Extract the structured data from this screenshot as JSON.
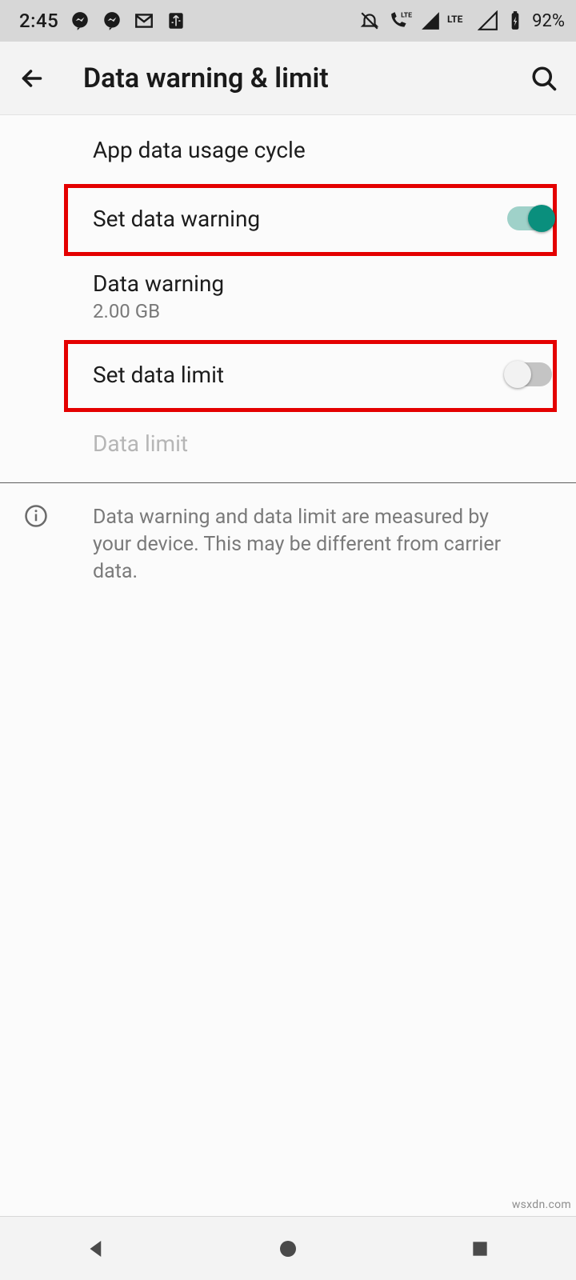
{
  "status": {
    "time": "2:45",
    "battery_percent": "92%"
  },
  "header": {
    "title": "Data warning & limit"
  },
  "rows": {
    "usage_cycle": {
      "label": "App data usage cycle"
    },
    "set_warning": {
      "label": "Set data warning",
      "enabled": true
    },
    "data_warning": {
      "label": "Data warning",
      "value": "2.00 GB"
    },
    "set_limit": {
      "label": "Set data limit",
      "enabled": false
    },
    "data_limit": {
      "label": "Data limit"
    }
  },
  "info_text": "Data warning and data limit are measured by your device. This may be different from carrier data.",
  "watermark": "wsxdn.com",
  "colors": {
    "accent": "#0a8f7d",
    "highlight": "#e40000"
  }
}
